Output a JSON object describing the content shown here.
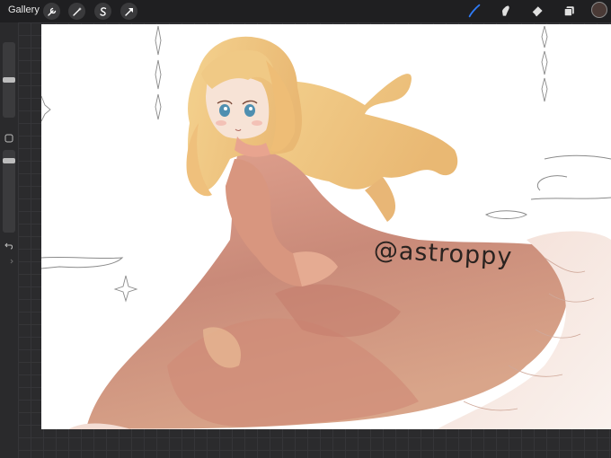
{
  "toolbar": {
    "gallery_label": "Gallery",
    "left_tools": [
      "wrench-icon",
      "magic-wand-icon",
      "selection-icon",
      "transform-arrow-icon"
    ],
    "right_tools": [
      "brush-icon",
      "smudge-icon",
      "eraser-icon",
      "layers-icon"
    ],
    "active_tool": "brush-icon",
    "accent_color": "#2f7bf6",
    "current_color": "#4a3a36"
  },
  "sidebar": {
    "brush_size": 0.5,
    "opacity": 0.9,
    "buttons": [
      "modify-square-icon",
      "undo-icon",
      "redo-icon"
    ]
  },
  "canvas": {
    "watermark_text": "@astroppy",
    "background": "#ffffff"
  }
}
